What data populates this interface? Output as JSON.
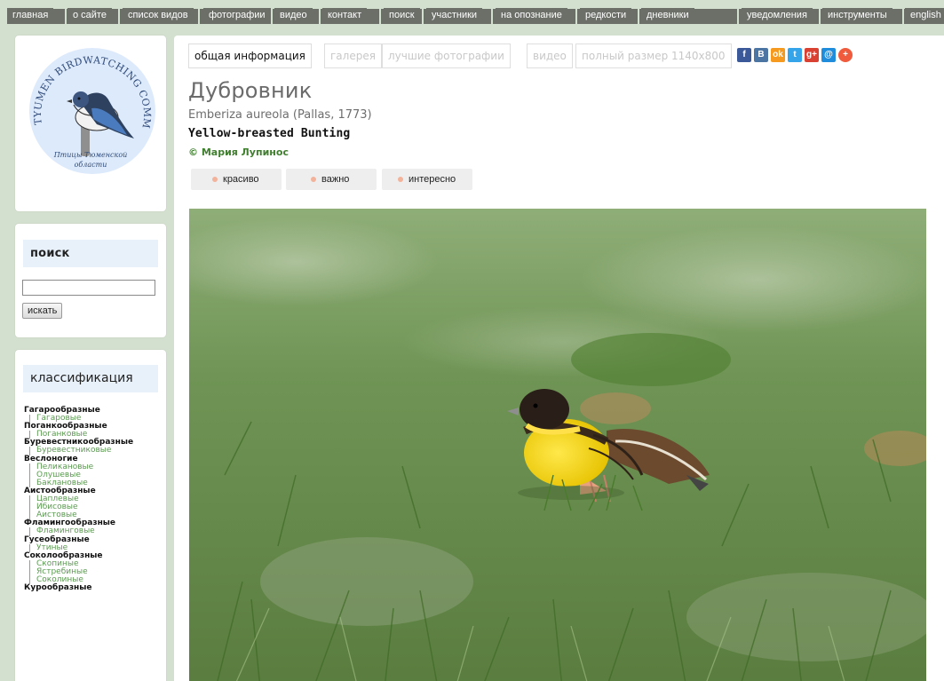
{
  "nav": {
    "items": [
      "главная",
      "о сайте",
      "список видов",
      "фотографии",
      "видео",
      "контакт",
      "поиск",
      "участники",
      "на опознание",
      "редкости",
      "дневники",
      "уведомления",
      "инструменты",
      "english"
    ]
  },
  "logo": {
    "ring_text": "TYUMEN BIRDWATCHING COMMUNITY",
    "caption_line1": "Птицы Тюменской",
    "caption_line2": "области"
  },
  "search": {
    "heading": "поиск",
    "input_value": "",
    "button_label": "искать"
  },
  "classification": {
    "heading": "классификация",
    "tree": [
      {
        "order": "Гагарообразные",
        "families": [
          "Гагаровые"
        ]
      },
      {
        "order": "Поганкообразные",
        "families": [
          "Поганковые"
        ]
      },
      {
        "order": "Буревестникообразные",
        "families": [
          "Буревестниковые"
        ]
      },
      {
        "order": "Веслоногие",
        "families": [
          "Пеликановые",
          "Олушевые",
          "Баклановые"
        ]
      },
      {
        "order": "Аистообразные",
        "families": [
          "Цаплевые",
          "Ибисовые",
          "Аистовые"
        ]
      },
      {
        "order": "Фламингообразные",
        "families": [
          "Фламинговые"
        ]
      },
      {
        "order": "Гусеобразные",
        "families": [
          "Утиные"
        ]
      },
      {
        "order": "Соколообразные",
        "families": [
          "Скопиные",
          "Ястребиные",
          "Соколиные"
        ]
      },
      {
        "order": "Курообразные",
        "families": []
      }
    ]
  },
  "tabs": [
    "общая информация",
    "галерея",
    "лучшие фотографии",
    "видео",
    "полный размер 1140x800"
  ],
  "share": [
    {
      "icon": "facebook-icon",
      "glyph": "f",
      "color": "#3b5998"
    },
    {
      "icon": "vkontakte-icon",
      "glyph": "B",
      "color": "#4c75a3"
    },
    {
      "icon": "odnoklassniki-icon",
      "glyph": "ok",
      "color": "#f59a1e"
    },
    {
      "icon": "twitter-icon",
      "glyph": "t",
      "color": "#35a4e8"
    },
    {
      "icon": "googleplus-icon",
      "glyph": "g+",
      "color": "#d94132"
    },
    {
      "icon": "mail-icon",
      "glyph": "@",
      "color": "#1f8ddb"
    },
    {
      "icon": "plus-icon",
      "glyph": "+",
      "color": "#ef5b3c"
    }
  ],
  "species": {
    "title": "Дубровник",
    "latin": "Emberiza aureola (Pallas, 1773)",
    "english": "Yellow-breasted Bunting",
    "author": "© Мария Лупинос"
  },
  "ratings": [
    "красиво",
    "важно",
    "интересно"
  ],
  "colors": {
    "page_bg": "#d4e0cf",
    "nav_bar": "#6b6f68",
    "author_green": "#3f7f2e",
    "family_green": "#5c9a52"
  }
}
